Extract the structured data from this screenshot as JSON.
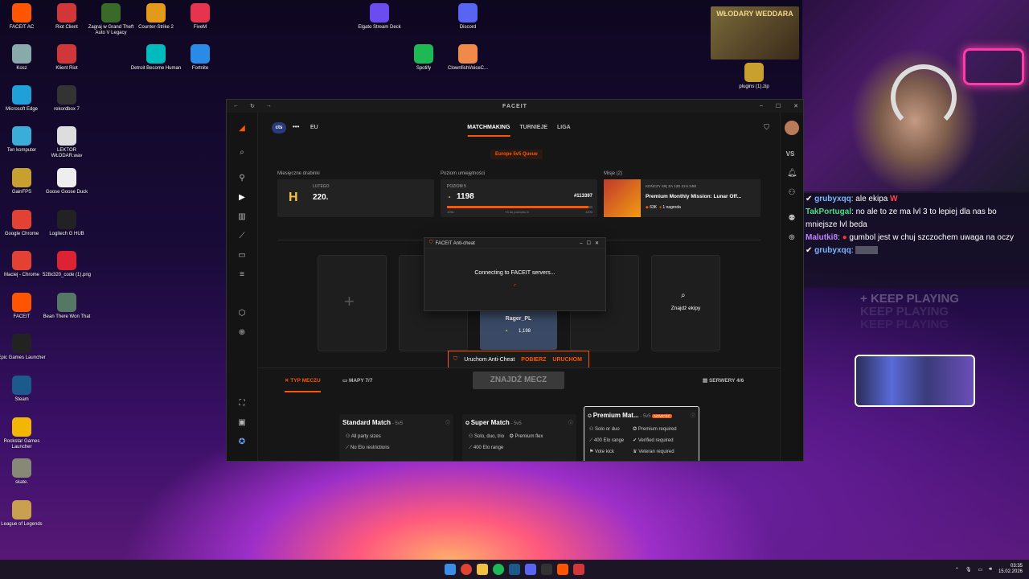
{
  "desktop": {
    "icons": [
      {
        "label": "FACEIT AC",
        "icon": "faceit-ac-icon",
        "color": "#ff5500"
      },
      {
        "label": "Riot Client",
        "icon": "riot-icon",
        "color": "#d13639"
      },
      {
        "label": "Zagraj w Grand Theft Auto V Legacy",
        "icon": "gta-icon",
        "color": "#3a6a2a"
      },
      {
        "label": "Counter-Strike 2",
        "icon": "cs2-icon",
        "color": "#e39a1a"
      },
      {
        "label": "FiveM",
        "icon": "fivem-icon",
        "color": "#e8334f"
      },
      {
        "label": "Kosz",
        "icon": "trash-icon",
        "color": "#8aa"
      },
      {
        "label": "Klient Riot",
        "icon": "riot-icon",
        "color": "#d13639"
      },
      {
        "label": "Detroit Become Human",
        "icon": "detroit-icon",
        "color": "#0bb"
      },
      {
        "label": "Fortnite",
        "icon": "fortnite-icon",
        "color": "#2a8ae8"
      },
      {
        "label": "Microsoft Edge",
        "icon": "edge-icon",
        "color": "#1fa0d8"
      },
      {
        "label": "rekordbox 7",
        "icon": "rekordbox-icon",
        "color": "#333"
      },
      {
        "label": "Ten komputer",
        "icon": "computer-icon",
        "color": "#3aaed8"
      },
      {
        "label": "LEKTOR WŁODAR.wav",
        "icon": "file-icon",
        "color": "#ddd"
      },
      {
        "label": "GainFPS",
        "icon": "gainfps-icon",
        "color": "#c8a030"
      },
      {
        "label": "Goose Goose Duck",
        "icon": "goose-icon",
        "color": "#eee"
      },
      {
        "label": "Google Chrome",
        "icon": "chrome-icon",
        "color": "#e34133"
      },
      {
        "label": "Logitech G HUB",
        "icon": "logitech-icon",
        "color": "#222"
      },
      {
        "label": "Maciej - Chrome",
        "icon": "chrome-icon",
        "color": "#e34133"
      },
      {
        "label": "528x320_code (1).png",
        "icon": "image-icon",
        "color": "#d23"
      },
      {
        "label": "FACEIT",
        "icon": "faceit-icon",
        "color": "#ff5500"
      },
      {
        "label": "Bean There Won That",
        "icon": "game-icon",
        "color": "#576"
      },
      {
        "label": "Epic Games Launcher",
        "icon": "epic-icon",
        "color": "#222"
      },
      {
        "label": "Steam",
        "icon": "steam-icon",
        "color": "#1b5a8a"
      },
      {
        "label": "Rockstar Games Launcher",
        "icon": "rockstar-icon",
        "color": "#f2b705"
      },
      {
        "label": "skate.",
        "icon": "skate-icon",
        "color": "#887"
      },
      {
        "label": "League of Legends",
        "icon": "lol-icon",
        "color": "#c8a050"
      },
      {
        "label": "Elgato Stream Deck",
        "icon": "streamdeck-icon",
        "color": "#6a4cf0"
      },
      {
        "label": "Discord",
        "icon": "discord-icon",
        "color": "#5865f2"
      },
      {
        "label": "Spotify",
        "icon": "spotify-icon",
        "color": "#1db954"
      },
      {
        "label": "ClownfishVoiceC...",
        "icon": "clownfish-icon",
        "color": "#f08a4a"
      },
      {
        "label": "plugins (1).zip",
        "icon": "zip-icon",
        "color": "#c8a030"
      }
    ]
  },
  "taskbar": {
    "time": "03:35",
    "date": "15.02.2026"
  },
  "window": {
    "title": "FACEIT",
    "logo": "cts",
    "region": "EU",
    "tabs": [
      "MATCHMAKING",
      "TURNIEJE",
      "LIGA"
    ],
    "queue_badge": "Europe 5v5 Queue",
    "monthly": {
      "label": "Miesięczne drabinki",
      "month": "LUTEGO",
      "value": "220."
    },
    "skill": {
      "label": "Poziom umiejętności",
      "level": "POZIOM 5",
      "elo": "1198",
      "rank": "#113397",
      "min": "1051",
      "progress_text": "+3 do poziomu 6",
      "max": "1200",
      "progress_fraction": 0.97
    },
    "missions": {
      "label": "Misje (2)",
      "ends": "KOŃCZY SIĘ ZA 13D 21H 24M",
      "title": "Premium Monthly Mission: Lunar Off...",
      "reward1": "63K",
      "reward2": "1 nagroda"
    },
    "modal": {
      "title": "FACEIT Anti-cheat",
      "text": "Connecting to FACEIT servers..."
    },
    "player": {
      "name": "Rager_PL",
      "elo": "1,198"
    },
    "find_team": "Znajdź ekipy",
    "anticheat": {
      "text": "Uruchom Anti-Cheat",
      "download": "POBIERZ",
      "run": "URUCHOM"
    },
    "bottom_tabs": {
      "match_type": "TYP MECZU",
      "maps": "MAPY 7/7",
      "servers": "SERWERY 4/6"
    },
    "find_match": "ZNAJDŹ MECZ",
    "matches": [
      {
        "title": "Standard Match",
        "mode": "5v5",
        "f1": "All party sizes",
        "f2": "No Elo restrictions",
        "f3": "",
        "f4": "",
        "f5": "",
        "f6": ""
      },
      {
        "title": "Super Match",
        "mode": "5v5",
        "f1": "Solo, duo, trio",
        "f2": "400 Elo range",
        "f3": "Premium flex",
        "f4": "",
        "f5": "",
        "f6": ""
      },
      {
        "title": "Premium Mat...",
        "mode": "5v5",
        "badge": "NOWOŚĆ",
        "f1": "Solo or duo",
        "f2": "400 Elo range",
        "f3": "Vote kick",
        "f4": "Premium required",
        "f5": "Verified required",
        "f6": "Veteran required"
      }
    ]
  },
  "stream": {
    "plugin_thumb": "WŁODARY WEDDARA",
    "chat": [
      {
        "user": "grubyxqq",
        "color": "#7fb4ff",
        "msg": "ale ekipa",
        "extra": "W"
      },
      {
        "user": "TakPortugal",
        "color": "#4ade80",
        "msg": "no ale to ze ma lvl 3 to lepiej dla nas bo mniejsze lvl beda",
        "extra": ""
      },
      {
        "user": "Malutki8",
        "color": "#c084fc",
        "msg": "gumbol jest w chuj szczochem uwaga na oczy",
        "extra": ""
      },
      {
        "user": "grubyxqq",
        "color": "#7fb4ff",
        "msg": "",
        "extra": ""
      }
    ],
    "keep_playing": "KEEP PLAYING"
  }
}
